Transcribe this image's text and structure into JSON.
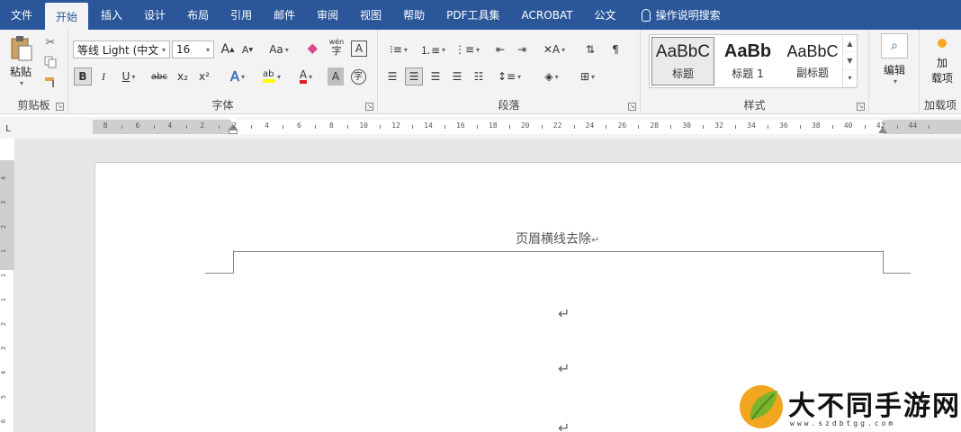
{
  "menu": {
    "tabs": [
      "文件",
      "开始",
      "插入",
      "设计",
      "布局",
      "引用",
      "邮件",
      "审阅",
      "视图",
      "帮助",
      "PDF工具集",
      "ACROBAT",
      "公文"
    ],
    "active_index": 1,
    "tell_me": "操作说明搜索"
  },
  "ribbon": {
    "clipboard": {
      "paste_label": "粘贴",
      "group_label": "剪贴板"
    },
    "font": {
      "font_name": "等线 Light (中文",
      "font_size": "16",
      "grow": "A",
      "shrink": "A",
      "case": "Aa",
      "bold": "B",
      "italic": "I",
      "underline": "U",
      "strike": "abc",
      "subscript": "x₂",
      "superscript": "x²",
      "text_effects": "A",
      "font_color": "A",
      "char_shading": "A",
      "enclose": "字",
      "phonetic": "wén",
      "border_char": "A",
      "group_label": "字体"
    },
    "paragraph": {
      "group_label": "段落"
    },
    "styles": {
      "items": [
        {
          "sample": "AaBbC",
          "name": "标题"
        },
        {
          "sample": "AaBb",
          "name": "标题 1"
        },
        {
          "sample": "AaBbC",
          "name": "副标题"
        }
      ],
      "group_label": "样式"
    },
    "editing": {
      "label": "编辑"
    },
    "addins": {
      "label_line1": "加",
      "label_line2": "载项",
      "group_label": "加载项"
    }
  },
  "ruler": {
    "tab_selector": "L",
    "numbers": [
      "8",
      "6",
      "4",
      "2",
      "2",
      "4",
      "6",
      "8",
      "10",
      "12",
      "14",
      "16",
      "18",
      "20",
      "22",
      "24",
      "26",
      "28",
      "30",
      "32",
      "34",
      "36",
      "38",
      "40",
      "42",
      "44"
    ],
    "vertical_numbers": [
      "4",
      "3",
      "2",
      "1",
      "1",
      "1",
      "2",
      "3",
      "4",
      "5",
      "6"
    ]
  },
  "document": {
    "header_text": "页眉横线去除",
    "para_mark": "↵"
  },
  "watermark": {
    "title": "大不同手游网",
    "url": "www.szdbtgg.com"
  }
}
